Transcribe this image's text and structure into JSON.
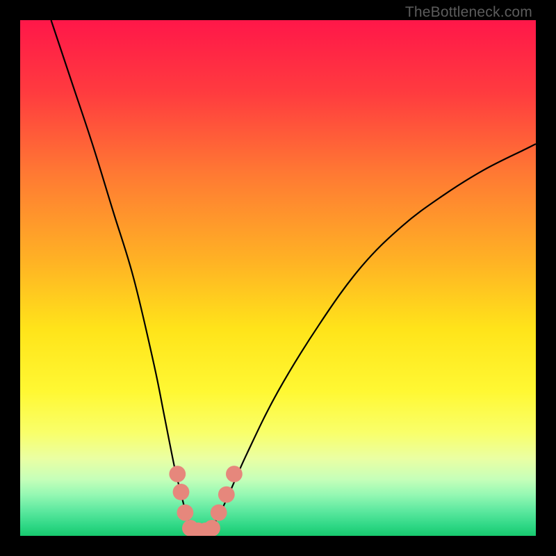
{
  "watermark": "TheBottleneck.com",
  "chart_data": {
    "type": "line",
    "title": "",
    "xlabel": "",
    "ylabel": "",
    "xlim": [
      0,
      100
    ],
    "ylim": [
      0,
      100
    ],
    "grid": false,
    "series": [
      {
        "name": "bottleneck-curve",
        "x": [
          6,
          10,
          14,
          18,
          22,
          26,
          28,
          30,
          31,
          32,
          33,
          34,
          35,
          36,
          37,
          38,
          40,
          44,
          50,
          58,
          66,
          74,
          82,
          90,
          98,
          100
        ],
        "values": [
          100,
          88,
          76,
          63,
          50,
          33,
          23,
          13,
          9,
          5,
          2,
          1,
          1,
          1,
          2,
          3,
          7,
          16,
          28,
          41,
          52,
          60,
          66,
          71,
          75,
          76
        ]
      }
    ],
    "markers": [
      {
        "name": "marker-left-1",
        "x": 30.5,
        "y": 12,
        "r": 1.6
      },
      {
        "name": "marker-left-2",
        "x": 31.2,
        "y": 8.5,
        "r": 1.6
      },
      {
        "name": "marker-left-3",
        "x": 32.0,
        "y": 4.5,
        "r": 1.6
      },
      {
        "name": "marker-right-1",
        "x": 38.5,
        "y": 4.5,
        "r": 1.6
      },
      {
        "name": "marker-right-2",
        "x": 40.0,
        "y": 8.0,
        "r": 1.6
      },
      {
        "name": "marker-right-3",
        "x": 41.5,
        "y": 12,
        "r": 1.6
      },
      {
        "name": "marker-bottom-1",
        "x": 33.0,
        "y": 1.5,
        "r": 1.6
      },
      {
        "name": "marker-bottom-2",
        "x": 34.5,
        "y": 1.0,
        "r": 1.6
      },
      {
        "name": "marker-bottom-3",
        "x": 36.0,
        "y": 1.0,
        "r": 1.6
      },
      {
        "name": "marker-bottom-4",
        "x": 37.2,
        "y": 1.5,
        "r": 1.6
      }
    ],
    "gradient_stops": [
      {
        "pct": 0,
        "color": "#ff1749"
      },
      {
        "pct": 14,
        "color": "#ff3b3f"
      },
      {
        "pct": 30,
        "color": "#ff7a33"
      },
      {
        "pct": 47,
        "color": "#ffb324"
      },
      {
        "pct": 60,
        "color": "#ffe41a"
      },
      {
        "pct": 72,
        "color": "#fff833"
      },
      {
        "pct": 80,
        "color": "#f9ff6a"
      },
      {
        "pct": 85,
        "color": "#eaffa3"
      },
      {
        "pct": 89,
        "color": "#c6ffb9"
      },
      {
        "pct": 92,
        "color": "#95f8b3"
      },
      {
        "pct": 95,
        "color": "#5fe9a0"
      },
      {
        "pct": 98,
        "color": "#2fd886"
      },
      {
        "pct": 100,
        "color": "#18c96e"
      }
    ],
    "marker_color": "#e6877c",
    "curve_color": "#000000"
  }
}
